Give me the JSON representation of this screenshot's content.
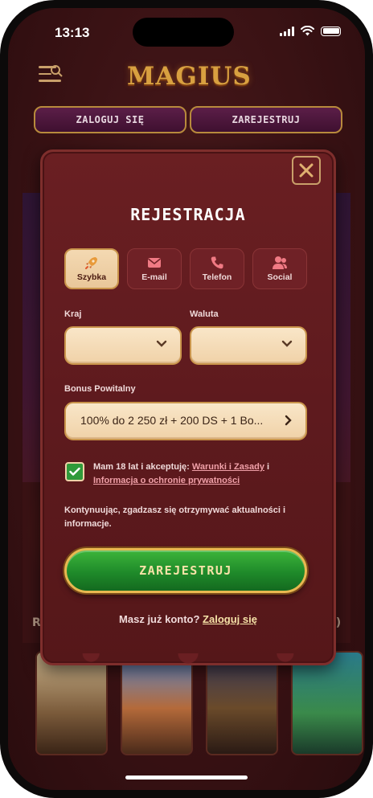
{
  "status_bar": {
    "time": "13:13",
    "signal_icon": "cellular-signal-icon",
    "wifi_icon": "wifi-icon",
    "battery_icon": "battery-icon"
  },
  "header": {
    "logo_text": "MAGIUS",
    "menu_icon": "menu-search-icon",
    "login_label": "ZALOGUJ SIĘ",
    "register_label": "ZAREJESTRUJ"
  },
  "background": {
    "section_letter_left": "R",
    "section_letter_right": "2)"
  },
  "modal": {
    "title": "REJESTRACJA",
    "close_icon": "close-icon",
    "tabs": [
      {
        "label": "Szybka",
        "icon": "rocket-icon",
        "active": true
      },
      {
        "label": "E-mail",
        "icon": "envelope-icon",
        "active": false
      },
      {
        "label": "Telefon",
        "icon": "phone-icon",
        "active": false
      },
      {
        "label": "Social",
        "icon": "users-icon",
        "active": false
      }
    ],
    "country_label": "Kraj",
    "country_value": "",
    "currency_label": "Waluta",
    "currency_value": "",
    "bonus_label": "Bonus Powitalny",
    "bonus_value": "100% do 2 250 zł + 200 DS + 1 Bo...",
    "terms_prefix": "Mam 18 lat i akceptuję: ",
    "terms_link": "Warunki i Zasady",
    "terms_mid": " i ",
    "privacy_link": "Informacja o ochronie prywatności",
    "terms_checked": true,
    "news_text": "Kontynuując, zgadzasz się otrzymywać aktualności i informacje.",
    "register_button": "ZAREJESTRUJ",
    "have_account": "Masz już konto? ",
    "login_link": "Zaloguj się"
  },
  "colors": {
    "modal_bg": "#5e1a1e",
    "accent_gold": "#c9944b",
    "button_green": "#1f8a2a",
    "field_bg": "#f0d2a8"
  }
}
